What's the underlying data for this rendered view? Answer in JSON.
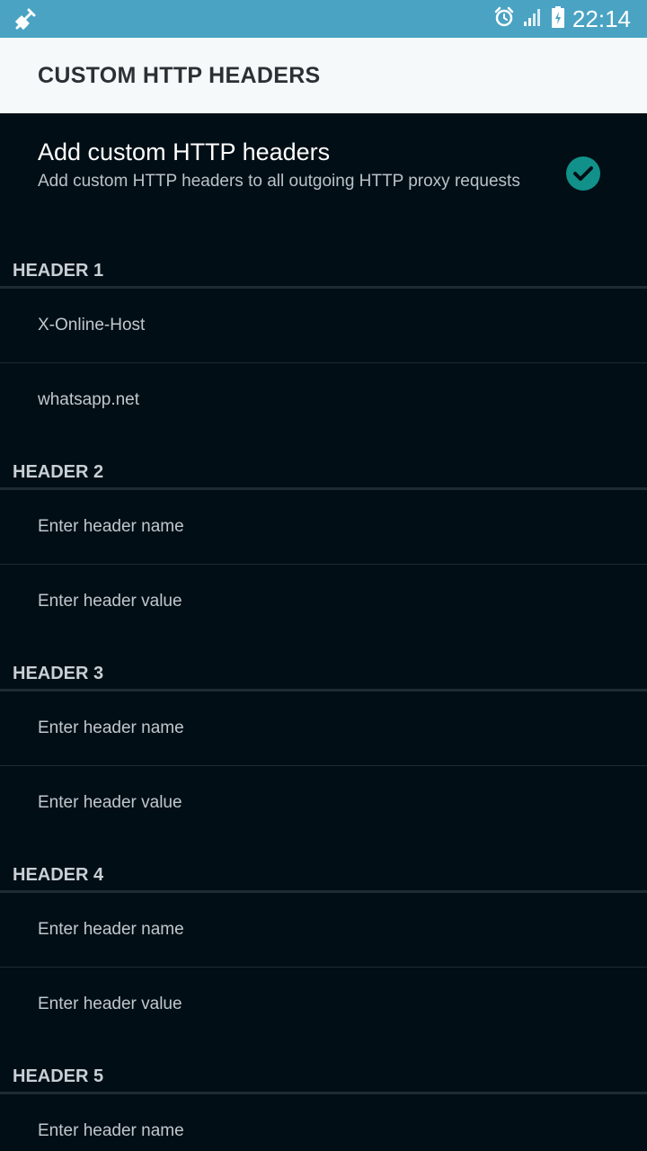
{
  "status_bar": {
    "time": "22:14",
    "icons": [
      "notification-plug-icon",
      "alarm-icon",
      "signal-icon",
      "battery-icon"
    ]
  },
  "app_bar": {
    "title": "CUSTOM HTTP HEADERS"
  },
  "toggle": {
    "title": "Add custom HTTP headers",
    "summary": "Add custom HTTP headers to all outgoing HTTP proxy requests",
    "checked": true,
    "check_color": "#12918a"
  },
  "headers": [
    {
      "label": "HEADER 1",
      "name": "X-Online-Host",
      "value": "whatsapp.net"
    },
    {
      "label": "HEADER 2",
      "name": "Enter header name",
      "value": "Enter header value"
    },
    {
      "label": "HEADER 3",
      "name": "Enter header name",
      "value": "Enter header value"
    },
    {
      "label": "HEADER 4",
      "name": "Enter header name",
      "value": "Enter header value"
    },
    {
      "label": "HEADER 5",
      "name": "Enter header name"
    }
  ],
  "colors": {
    "status_bar": "#4aa3c3",
    "app_bar": "#f6f9f9",
    "background": "#020e16",
    "accent": "#12918a"
  }
}
